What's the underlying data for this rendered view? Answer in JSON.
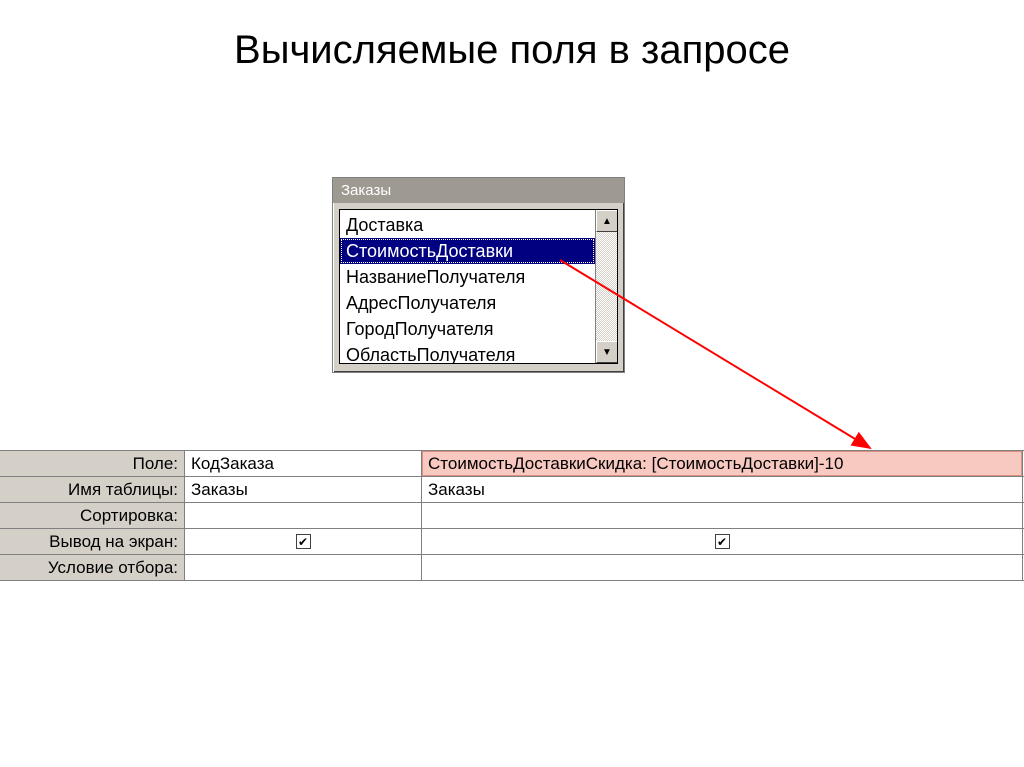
{
  "title": "Вычисляемые поля в запросе",
  "table_panel": {
    "title": "Заказы",
    "items": [
      {
        "label": "Доставка"
      },
      {
        "label": "СтоимостьДоставки"
      },
      {
        "label": "НазваниеПолучателя"
      },
      {
        "label": "АдресПолучателя"
      },
      {
        "label": "ГородПолучателя"
      },
      {
        "label": "ОбластьПолучателя"
      }
    ],
    "selected_index": 1
  },
  "grid": {
    "labels": {
      "field": "Поле:",
      "table": "Имя таблицы:",
      "sort": "Сортировка:",
      "show": "Вывод на экран:",
      "criteria": "Условие отбора:"
    },
    "columns": [
      {
        "field": "КодЗаказа",
        "table": "Заказы",
        "sort": "",
        "show": true,
        "criteria": ""
      },
      {
        "field": "СтоимостьДоставкиСкидка: [СтоимостьДоставки]-10",
        "table": "Заказы",
        "sort": "",
        "show": true,
        "criteria": ""
      }
    ]
  },
  "glyphs": {
    "up": "▲",
    "down": "▼",
    "check": "✔"
  }
}
